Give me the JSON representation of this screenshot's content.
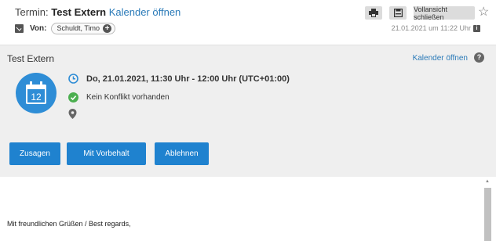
{
  "header": {
    "title_prefix": "Termin:",
    "subject": "Test Extern",
    "calendar_link": "Kalender öffnen",
    "from_label": "Von:",
    "from_name": "Schuldt, Timo",
    "close_fullview": "Vollansicht schließen",
    "date": "21.01.2021 um 11:22 Uhr"
  },
  "invitation": {
    "title": "Test Extern",
    "calendar_link": "Kalender öffnen",
    "help": "?",
    "calendar_day": "12",
    "datetime": "Do, 21.01.2021, 11:30 Uhr - 12:00 Uhr (UTC+01:00)",
    "conflict": "Kein Konflikt vorhanden",
    "location": "",
    "buttons": {
      "accept": "Zusagen",
      "tentative": "Mit Vorbehalt",
      "decline": "Ablehnen"
    }
  },
  "body": {
    "greeting": "Mit freundlichen Grüßen / Best regards,"
  },
  "colors": {
    "accent": "#1f82cf",
    "link": "#2a7ab8",
    "success": "#4caf50"
  }
}
